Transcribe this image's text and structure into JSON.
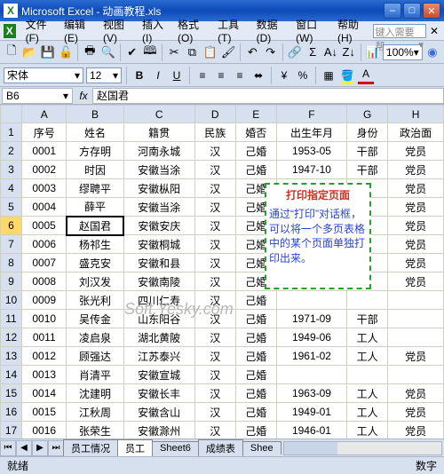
{
  "window": {
    "app": "Microsoft Excel",
    "file": "动画教程.xls"
  },
  "menus": [
    "文件(F)",
    "编辑(E)",
    "视图(V)",
    "插入(I)",
    "格式(O)",
    "工具(T)",
    "数据(D)",
    "窗口(W)",
    "帮助(H)"
  ],
  "help_placeholder": "键入需要帮…",
  "toolbar": {
    "zoom": "100%"
  },
  "font": {
    "name": "宋体",
    "size": "12"
  },
  "cell_ref": "B6",
  "formula": "赵国君",
  "columns": [
    "A",
    "B",
    "C",
    "D",
    "E",
    "F",
    "G",
    "H"
  ],
  "headers": [
    "序号",
    "姓名",
    "籍贯",
    "民族",
    "婚否",
    "出生年月",
    "身份",
    "政治面"
  ],
  "rows": [
    [
      "0001",
      "方存明",
      "河南永城",
      "汉",
      "己婚",
      "1953-05",
      "干部",
      "党员"
    ],
    [
      "0002",
      "时因",
      "安徽当涂",
      "汉",
      "己婚",
      "1947-10",
      "干部",
      "党员"
    ],
    [
      "0003",
      "缪聘平",
      "安徽枞阳",
      "汉",
      "己婚",
      "",
      "",
      "党员"
    ],
    [
      "0004",
      "薛平",
      "安徽当涂",
      "汉",
      "己婚",
      "",
      "",
      "党员"
    ],
    [
      "0005",
      "赵国君",
      "安徽安庆",
      "汉",
      "己婚",
      "",
      "",
      "党员"
    ],
    [
      "0006",
      "杨祁生",
      "安徽桐城",
      "汉",
      "己婚",
      "",
      "",
      "党员"
    ],
    [
      "0007",
      "盛克安",
      "安徽和县",
      "汉",
      "己婚",
      "",
      "",
      "党员"
    ],
    [
      "0008",
      "刘汉发",
      "安徽南陵",
      "汉",
      "己婚",
      "",
      "",
      "党员"
    ],
    [
      "0009",
      "张光利",
      "四川仁寿",
      "汉",
      "己婚",
      "",
      "",
      ""
    ],
    [
      "0010",
      "吴传金",
      "山东阳谷",
      "汉",
      "己婚",
      "1971-09",
      "干部",
      ""
    ],
    [
      "0011",
      "凌启泉",
      "湖北黄陂",
      "汉",
      "己婚",
      "1949-06",
      "工人",
      ""
    ],
    [
      "0012",
      "顾强达",
      "江苏泰兴",
      "汉",
      "己婚",
      "1961-02",
      "工人",
      "党员"
    ],
    [
      "0013",
      "肖清平",
      "安徽宣城",
      "汉",
      "己婚",
      "",
      "",
      ""
    ],
    [
      "0014",
      "沈建明",
      "安徽长丰",
      "汉",
      "己婚",
      "1963-09",
      "工人",
      "党员"
    ],
    [
      "0015",
      "江秋周",
      "安徽含山",
      "汉",
      "己婚",
      "1949-01",
      "工人",
      "党员"
    ],
    [
      "0016",
      "张荣生",
      "安徽滁州",
      "汉",
      "己婚",
      "1946-01",
      "工人",
      "党员"
    ]
  ],
  "callout": {
    "title": "打印指定页面",
    "body": "通过“打印”对话框，可以将一个多页表格中的某个页面单独打印出来。"
  },
  "watermark": "Soft.Yesky.com",
  "tabs": [
    "员工情况",
    "员工",
    "Sheet6",
    "成绩表",
    "Shee"
  ],
  "status": {
    "left": "就绪",
    "right": "数字"
  }
}
